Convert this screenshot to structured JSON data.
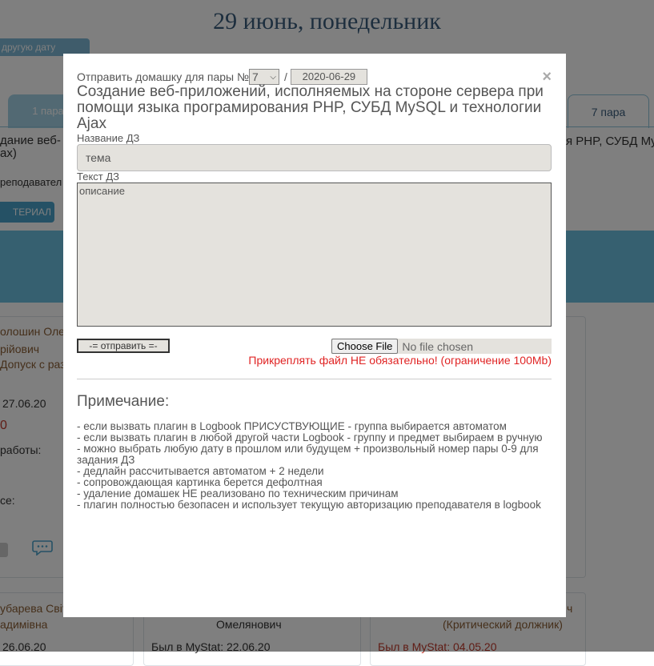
{
  "background": {
    "title": "29 июнь, понедельник",
    "other_date_button": "другую дату",
    "tab_1": "1 пара",
    "tab_7": "7 пара",
    "subject_left_line1": "дание веб-",
    "subject_left_line2": "ax)",
    "subject_right": "я PHP, СУБД MySQL",
    "teacher_label": "реподавател",
    "material_button": "ТЕРИАЛ",
    "card1": {
      "name_line1": "олошин Оле",
      "name_line2": "рійович",
      "status": "Допуск с раз",
      "date": "27.06.20",
      "mark": "0",
      "works": "работы:",
      "label_se": "се:"
    },
    "card2": {
      "name_line1": "убарева Світ",
      "name_line2": "адимівна",
      "date": "26.06.20"
    },
    "card3": {
      "name": "Омелянович",
      "mystat": "Был в MyStat: 22.06.20"
    },
    "card4": {
      "name_tail": "ч",
      "status": "(Критический должник)",
      "mystat": "Был в MyStat: 04.05.20"
    }
  },
  "modal": {
    "send_label": "Отправить домашку для пары №",
    "pair_number": "7",
    "date_separator": "/",
    "date_value": "2020-06-29",
    "close_symbol": "×",
    "subject": "Создание веб-приложений, исполняемых на стороне сервера при помощи языка програмирования PHP, СУБД MySQL и технологии Ajax",
    "topic_label": "Название ДЗ",
    "topic_placeholder": "тема",
    "text_label": "Текст ДЗ",
    "text_placeholder": "описание",
    "send_button": "-= отправить =-",
    "file_button": "Choose File",
    "file_status": "No file chosen",
    "file_warning": "Прикреплять файл НЕ обязательно! (ограничение 100Mb)",
    "note_title": "Примечание:",
    "notes": [
      "- если вызвать плагин в Logbook ПРИСУСТВУЮЩИЕ - группа выбирается автоматом",
      "- если вызвать плагин в любой другой части Logbook - группу и предмет выбираем в ручную",
      "- можно выбрать любую дату в прошлом или будущем + произвольный номер пары 0-9 для задания ДЗ",
      "- дедлайн рассчитывается автоматом + 2 недели",
      "- сопровождающая картинка берется дефолтная",
      "- удаление домашек НЕ реализовано по техническим причинам",
      "- плагин полностью безопасен и использует текущую авторизацию преподавателя в logbook"
    ]
  },
  "colors": {
    "overlay": "rgba(0,0,0,0.5)",
    "warning_red": "#e02424",
    "input_bg": "#e4e2dd",
    "title_blue": "#3a5d7c"
  }
}
